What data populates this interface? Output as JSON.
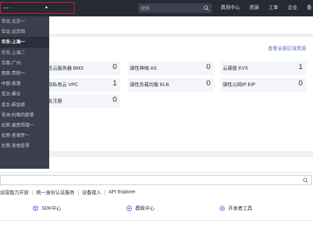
{
  "header": {
    "region_selected": "—",
    "search_placeholder": "搜索",
    "nav": [
      "费用中心",
      "资源",
      "工单",
      "企业",
      "备"
    ]
  },
  "region_dropdown": {
    "options": [
      "华北-北京一",
      "华北-北京四",
      "华东-上海一",
      "华东-上海二",
      "华南-广州",
      "西南-贵阳一",
      "中国-香港",
      "亚太-曼谷",
      "亚太-新加坡",
      "非洲-约翰内斯堡",
      "拉美-墨西哥城一",
      "拉美-圣保罗一",
      "拉美-圣地亚哥"
    ],
    "active_index": 2
  },
  "resources": {
    "view_all_link": "查看全部区域资源",
    "items": [
      {
        "label": "弹性云服务器 BMS",
        "count": "0"
      },
      {
        "label": "弹性伸缩 AS",
        "count": "0"
      },
      {
        "label": "云硬盘 EVS",
        "count": "1"
      },
      {
        "label": "虚拟私有云 VPC",
        "count": "1"
      },
      {
        "label": "弹性负载均衡 ELB",
        "count": "0"
      },
      {
        "label": "弹性公网IP EIP",
        "count": "0"
      },
      {
        "label": "域名注册",
        "count": "0"
      }
    ]
  },
  "api": {
    "tags": [
      "运营能力开放",
      "统一身份认证服务",
      "设备接入",
      "API Explorer"
    ],
    "tools": [
      "SDK中心",
      "模板中心",
      "开发者工具"
    ]
  },
  "colors": {
    "topbar": "#252a35",
    "dropdown": "#3b3f4c",
    "highlight_border": "#e02020",
    "link": "#526ecc"
  }
}
